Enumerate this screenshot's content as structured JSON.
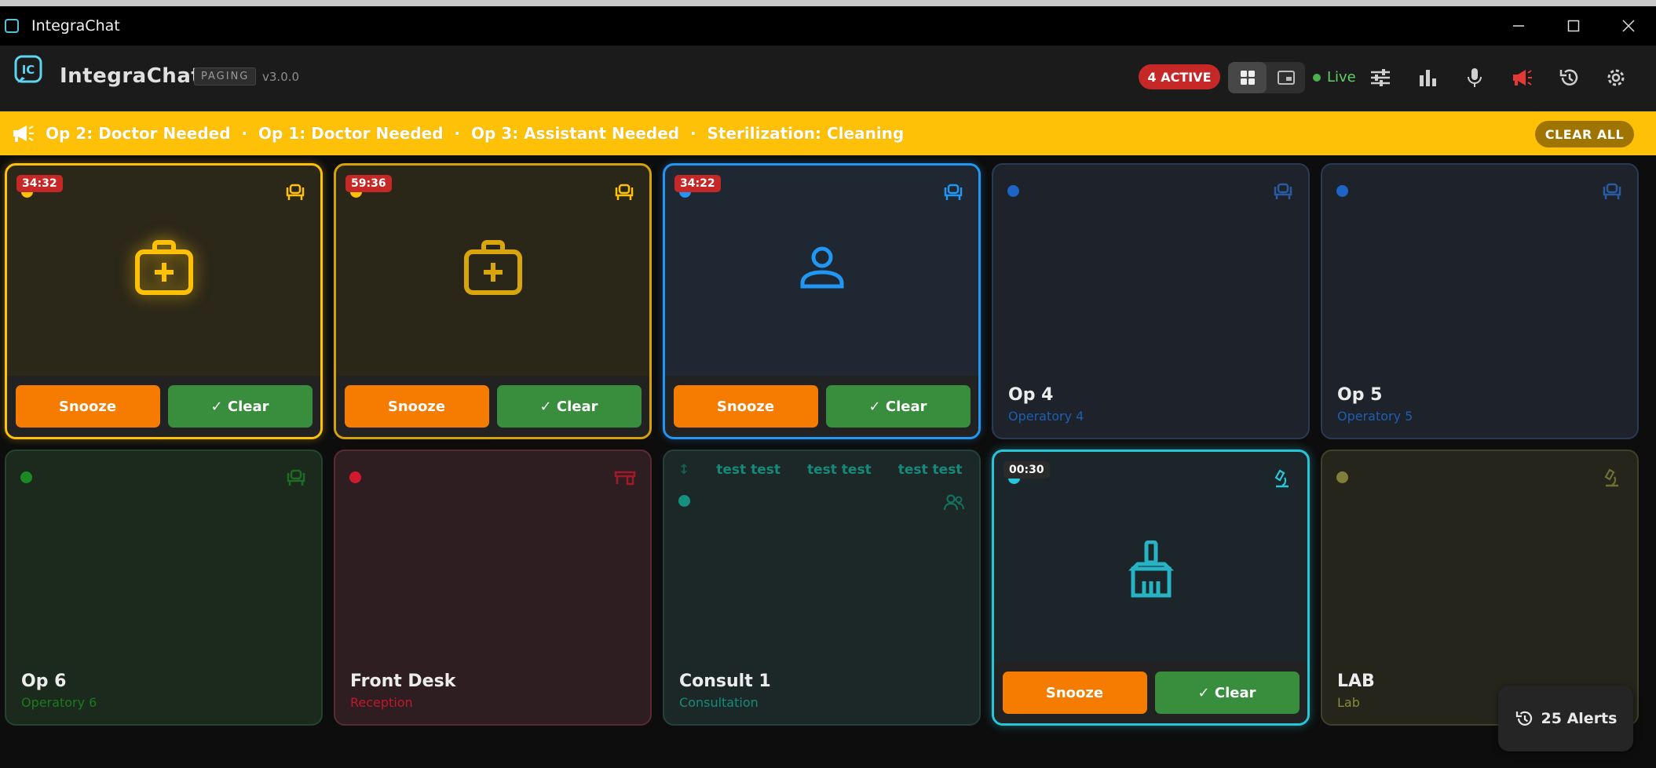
{
  "window": {
    "title": "IntegraChat"
  },
  "header": {
    "brand": "IntegraChat",
    "mode": "PAGING",
    "version": "v3.0.0",
    "active_badge": "4 ACTIVE",
    "live_label": "Live"
  },
  "banner": {
    "text": "Op 2: Doctor Needed  ·  Op 1: Doctor Needed  ·  Op 3: Assistant Needed  ·  Sterilization: Cleaning",
    "clear_all": "CLEAR ALL"
  },
  "cards": [
    {
      "timer": "34:32",
      "icon": "medical-kit-icon",
      "snooze": "Snooze",
      "clear": "✓ Clear",
      "color": "#ffc107"
    },
    {
      "timer": "59:36",
      "icon": "medical-kit-icon",
      "snooze": "Snooze",
      "clear": "✓ Clear",
      "color": "#ffc107"
    },
    {
      "timer": "34:22",
      "icon": "person-icon",
      "snooze": "Snooze",
      "clear": "✓ Clear",
      "color": "#2196f3"
    },
    {
      "name": "Op 4",
      "sub": "Operatory 4",
      "color": "#1e5fb0"
    },
    {
      "name": "Op 5",
      "sub": "Operatory 5",
      "color": "#1e5fb0"
    },
    {
      "name": "Op 6",
      "sub": "Operatory 6",
      "color": "#1b7a1f"
    },
    {
      "name": "Front Desk",
      "sub": "Reception",
      "color": "#c0182c"
    },
    {
      "name": "Consult 1",
      "sub": "Consultation",
      "color": "#168b7b",
      "marquee": [
        "test test",
        "test test",
        "test test"
      ]
    },
    {
      "timer": "00:30",
      "icon": "broom-icon",
      "snooze": "Snooze",
      "clear": "✓ Clear",
      "color": "#26c6da"
    },
    {
      "name": "LAB",
      "sub": "Lab",
      "color": "#8a8a3a"
    }
  ],
  "alerts_button": "25 Alerts"
}
